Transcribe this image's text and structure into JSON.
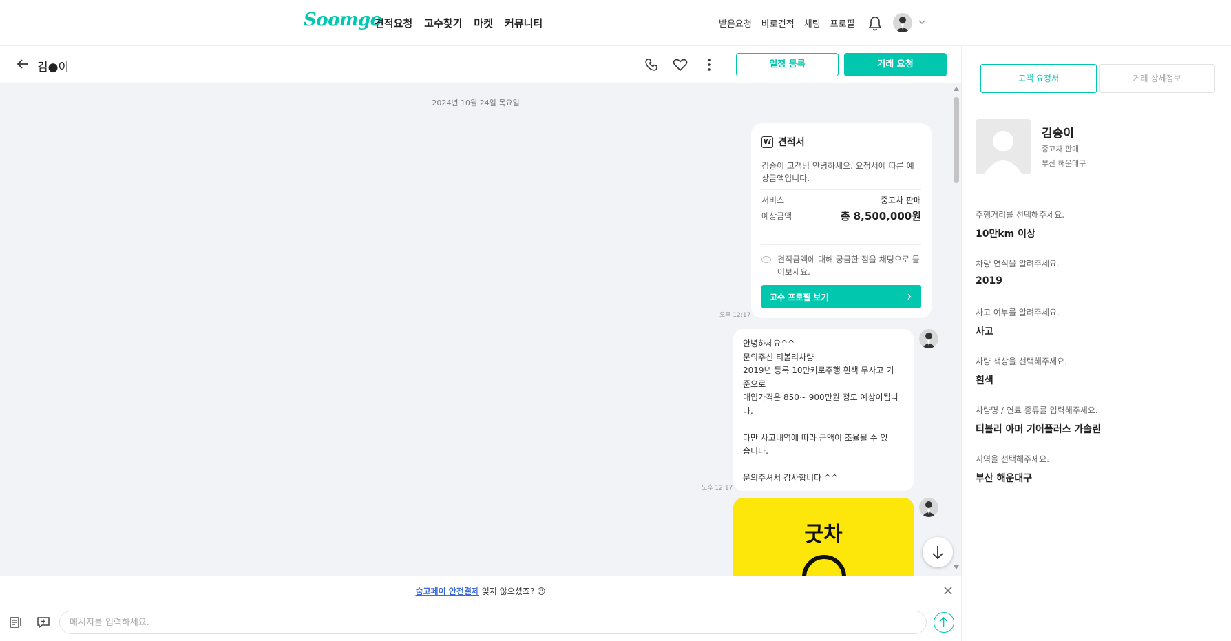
{
  "nav": {
    "logo": "Soomgo",
    "menu": [
      "견적요청",
      "고수찾기",
      "마켓",
      "커뮤니티"
    ],
    "right_menu": [
      "받은요청",
      "바로견적",
      "채팅",
      "프로필"
    ],
    "icons": [
      "bell-icon",
      "avatar",
      "chevron-down-icon"
    ]
  },
  "chat_header": {
    "name": "김●이",
    "schedule_button": "일정 등록",
    "deal_button": "거래 요청",
    "icons": [
      "back-arrow-icon",
      "phone-icon",
      "heart-icon",
      "more-vertical-icon"
    ]
  },
  "chat": {
    "date": "2024년 10월 24일 목요일",
    "quote": {
      "title": "견적서",
      "description": "김송이 고객님 안녕하세요. 요청서에 따른 예상금액입니다.",
      "service_label": "서비스",
      "service_value": "중고차 판매",
      "price_label": "예상금액",
      "price_value": "총 8,500,000원",
      "note": "견적금액에 대해 궁금한 점을 채팅으로 물어보세요.",
      "profile_button": "고수 프로필 보기",
      "time": "오후 12:17"
    },
    "message": {
      "lines": [
        "안녕하세요^^",
        "문의주신 티볼리차량",
        "2019년 등록 10만키로주행 흰색 무사고 기",
        "준으로",
        "매입가격은 850~ 900만원 정도 예상이됩니",
        "다.",
        "",
        "다만 사고내역에  따라 금액이 조율될 수 있",
        "습니다.",
        "",
        "문의주셔서 감사합니다 ^^"
      ],
      "time": "오후 12:17"
    },
    "image_text": "굿차"
  },
  "notice": {
    "link": "숨고페이 안전결제",
    "text": " 잊지 않으셨죠? 😉"
  },
  "composer": {
    "placeholder": "메시지를 입력하세요."
  },
  "right_panel": {
    "tabs": [
      "고객 요청서",
      "거래 상세정보"
    ],
    "customer": {
      "name": "김송이",
      "service": "중고차 판매",
      "area": "부산 해운대구"
    },
    "qa": [
      {
        "q": "주행거리를 선택해주세요.",
        "a": "10만km 이상"
      },
      {
        "q": "차량 연식을 알려주세요.",
        "a": "2019"
      },
      {
        "q": "사고 여부를 알려주세요.",
        "a": "사고"
      },
      {
        "q": "차량 색상을 선택해주세요.",
        "a": "흰색"
      },
      {
        "q": "차량명 / 연료 종류를 입력해주세요.",
        "a": "티볼리 아머 기어플러스 가솔린"
      },
      {
        "q": "지역을 선택해주세요.",
        "a": "부산 해운대구"
      }
    ]
  },
  "colors": {
    "accent": "#00c7ae",
    "chat_background": "#f2f3f6",
    "image_background": "#fde70a",
    "link": "#3a6ad8"
  }
}
